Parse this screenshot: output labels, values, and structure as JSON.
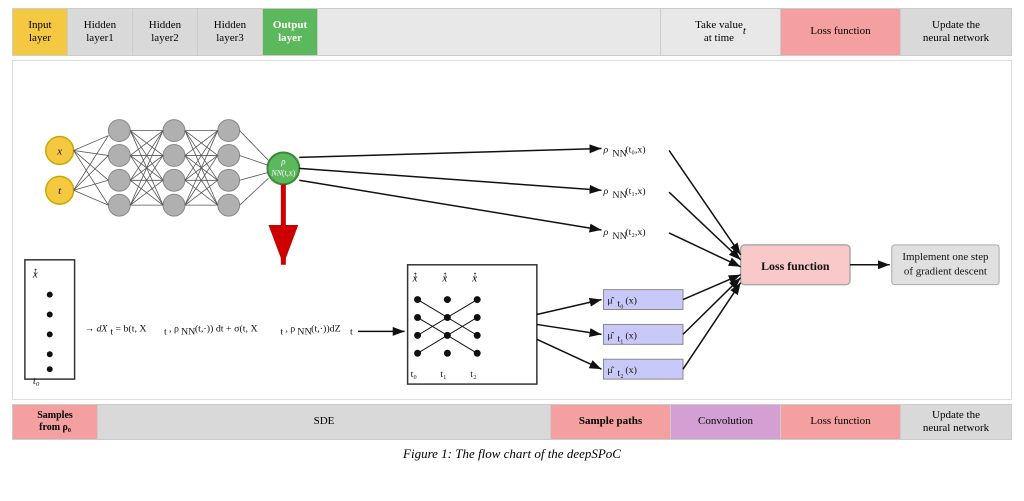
{
  "header": {
    "cells": [
      {
        "label": "Input\nlayer",
        "class": "hc-input"
      },
      {
        "label": "Hidden\nlayer1",
        "class": "hc-hidden1"
      },
      {
        "label": "Hidden\nlayer2",
        "class": "hc-hidden2"
      },
      {
        "label": "Hidden\nlayer3",
        "class": "hc-hidden3"
      },
      {
        "label": "Output\nlayer",
        "class": "hc-output"
      },
      {
        "label": "",
        "class": "hc-spacer"
      },
      {
        "label": "Take value\nat time t",
        "class": "hc-takeval"
      },
      {
        "label": "Loss function",
        "class": "hc-loss-top"
      },
      {
        "label": "Update the\nneural network",
        "class": "hc-update-top"
      }
    ]
  },
  "footer": {
    "cells": [
      {
        "label": "Samples\nfrom ρ₀",
        "class": "fc-samples"
      },
      {
        "label": "SDE",
        "class": "fc-sde"
      },
      {
        "label": "Sample paths",
        "class": "fc-paths"
      },
      {
        "label": "Convolution",
        "class": "fc-conv"
      },
      {
        "label": "Loss function",
        "class": "fc-loss"
      },
      {
        "label": "Update the\nneural network",
        "class": "fc-update"
      }
    ]
  },
  "caption": "Figure 1: The flow chart of the deepSPoC"
}
